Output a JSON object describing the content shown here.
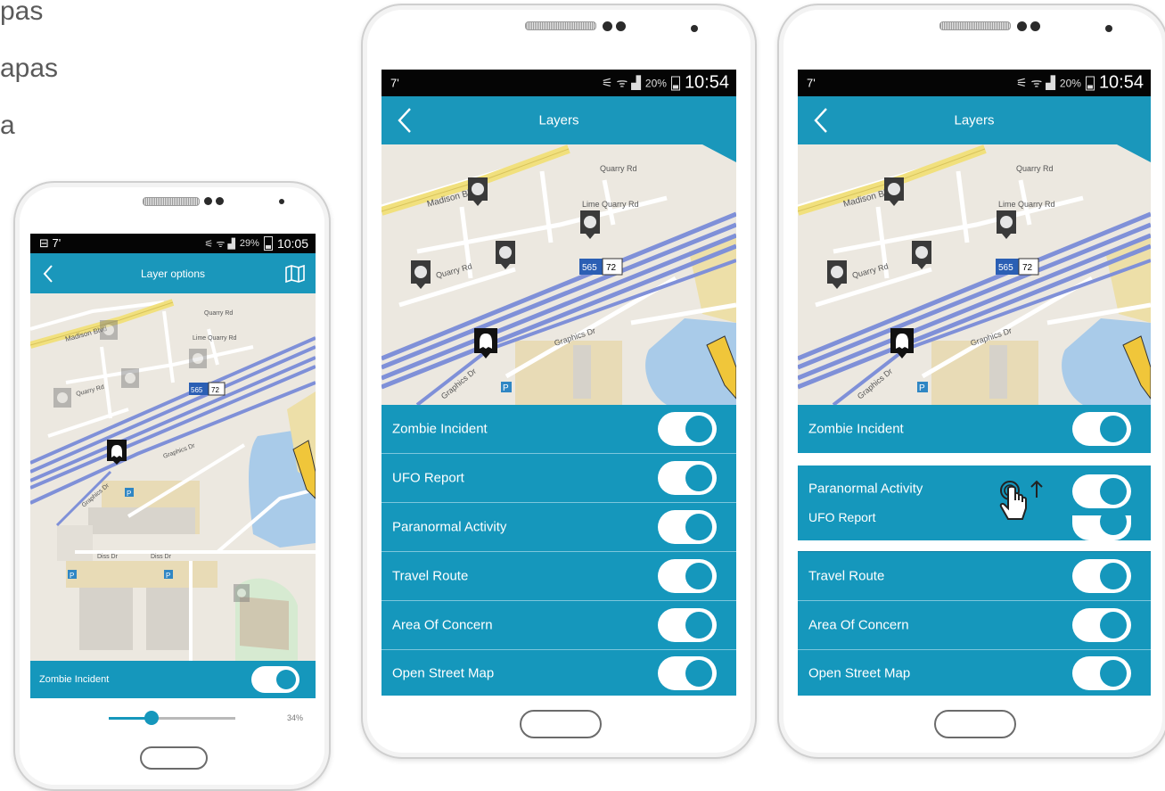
{
  "side_text": [
    "pas",
    "apas",
    "a"
  ],
  "left_phone": {
    "status": {
      "left": "⊟  7'",
      "battery_pct": "29%",
      "time": "10:05"
    },
    "appbar": {
      "title": "Layer options"
    },
    "map_labels": [
      "Madison Blvd",
      "Quarry Rd",
      "Lime Quarry Rd",
      "Quarry Rd",
      "565",
      "72",
      "Graphics Dr",
      "Graphics Dr",
      "Diss Dr",
      "Diss Dr",
      "P",
      "P",
      "P",
      "P"
    ],
    "option": {
      "label": "Zombie Incident",
      "on": true
    },
    "slider": {
      "value": 34,
      "label": "34%"
    }
  },
  "middle_phone": {
    "status": {
      "left": "7'",
      "battery_pct": "20%",
      "time": "10:54"
    },
    "appbar": {
      "title": "Layers"
    },
    "map_labels": [
      "Madison Blvd",
      "Quarry Rd",
      "Lime Quarry Rd",
      "Quarry Rd",
      "565",
      "72",
      "Graphics Dr",
      "Graphics Dr",
      "P"
    ],
    "layers": [
      {
        "label": "Zombie Incident",
        "on": true
      },
      {
        "label": "UFO Report",
        "on": true
      },
      {
        "label": "Paranormal Activity",
        "on": true
      },
      {
        "label": "Travel Route",
        "on": true
      },
      {
        "label": "Area Of Concern",
        "on": true
      },
      {
        "label": "Open Street Map",
        "on": true
      }
    ]
  },
  "right_phone": {
    "status": {
      "left": "7'",
      "battery_pct": "20%",
      "time": "10:54"
    },
    "appbar": {
      "title": "Layers"
    },
    "map_labels": [
      "Madison Blvd",
      "Quarry Rd",
      "Lime Quarry Rd",
      "Quarry Rd",
      "565",
      "72",
      "Graphics Dr",
      "Graphics Dr",
      "P"
    ],
    "layers": [
      {
        "label": "Zombie Incident",
        "on": true
      },
      {
        "label": "Paranormal Activity",
        "on": true
      },
      {
        "label": "UFO Report",
        "on": true
      },
      {
        "label": "Travel Route",
        "on": true
      },
      {
        "label": "Area Of Concern",
        "on": true
      },
      {
        "label": "Open Street Map",
        "on": true
      }
    ]
  },
  "colors": {
    "accent": "#1597bc",
    "appbar": "#1a97bb",
    "highway": "#7f90d8",
    "road_yellow": "#f1e07d",
    "water": "#a9cbe9",
    "map_bg": "#ece8e0"
  }
}
